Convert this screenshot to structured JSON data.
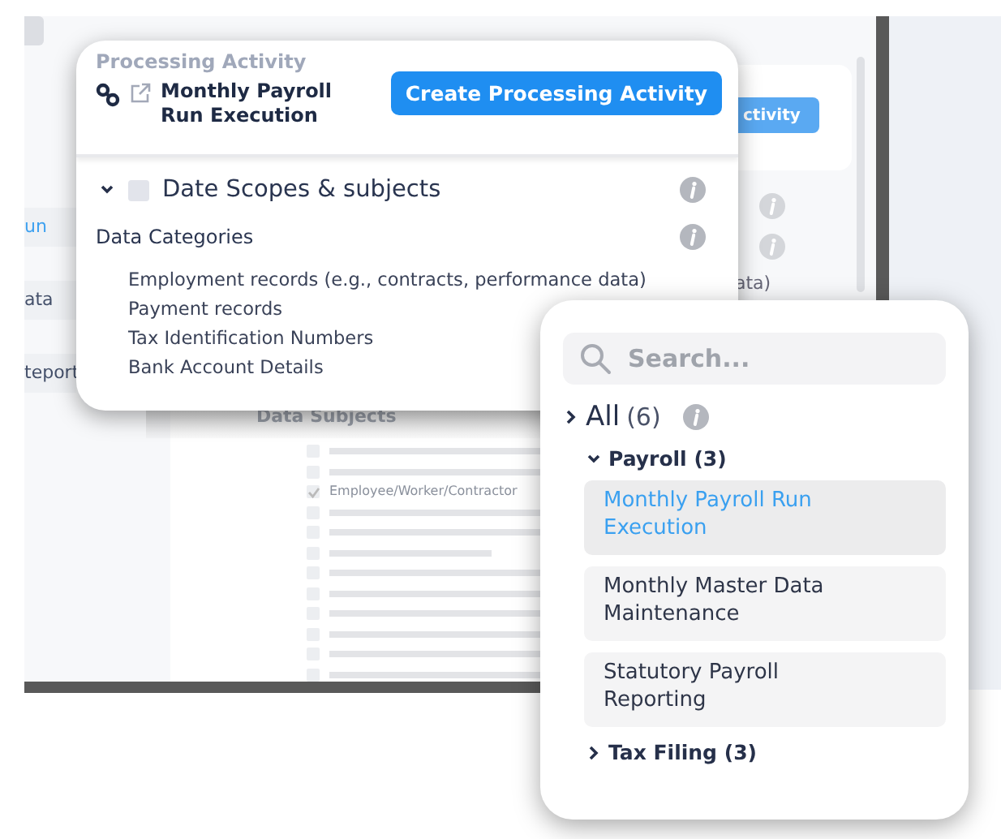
{
  "background_window": {
    "sidebar_items": [
      {
        "label": "un",
        "selected": true
      },
      {
        "label": "ata",
        "selected": false
      },
      {
        "label": "teport",
        "selected": false
      }
    ],
    "action_button": "ctivity",
    "cut_text": "ata)",
    "section_title": "Data Subjects",
    "subjects": [
      {
        "kind": "bar",
        "checked": false
      },
      {
        "kind": "bar",
        "checked": false
      },
      {
        "kind": "text",
        "label": "Employee/Worker/Contractor",
        "checked": true
      },
      {
        "kind": "bar",
        "checked": false
      },
      {
        "kind": "bar",
        "checked": false
      },
      {
        "kind": "short",
        "checked": false
      },
      {
        "kind": "bar",
        "checked": false
      },
      {
        "kind": "bar",
        "checked": false
      },
      {
        "kind": "bar",
        "checked": false
      },
      {
        "kind": "bar",
        "checked": false
      },
      {
        "kind": "bar",
        "checked": false
      },
      {
        "kind": "bar",
        "checked": false
      }
    ]
  },
  "activity_card": {
    "title": "Processing Activity",
    "name": "Monthly Payroll Run Execution",
    "button": "Create Processing Activity",
    "section": {
      "title": "Date Scopes & subjects",
      "expanded": true,
      "checked": false
    },
    "categories": {
      "title": "Data Categories",
      "items": [
        "Employment records (e.g., contracts, performance data)",
        "Payment records",
        "Tax Identification Numbers",
        "Bank Account Details"
      ]
    }
  },
  "search_card": {
    "search": {
      "placeholder": "Search..."
    },
    "root": {
      "label": "All",
      "count": "(6)",
      "expanded": false
    },
    "groups": [
      {
        "label": "Payroll (3)",
        "expanded": true,
        "items": [
          {
            "label": "Monthly Payroll Run Execution",
            "selected": true
          },
          {
            "label": "Monthly Master Data Maintenance",
            "selected": false
          },
          {
            "label": "Statutory Payroll Reporting",
            "selected": false
          }
        ]
      },
      {
        "label": "Tax Filing (3)",
        "expanded": false
      }
    ]
  }
}
